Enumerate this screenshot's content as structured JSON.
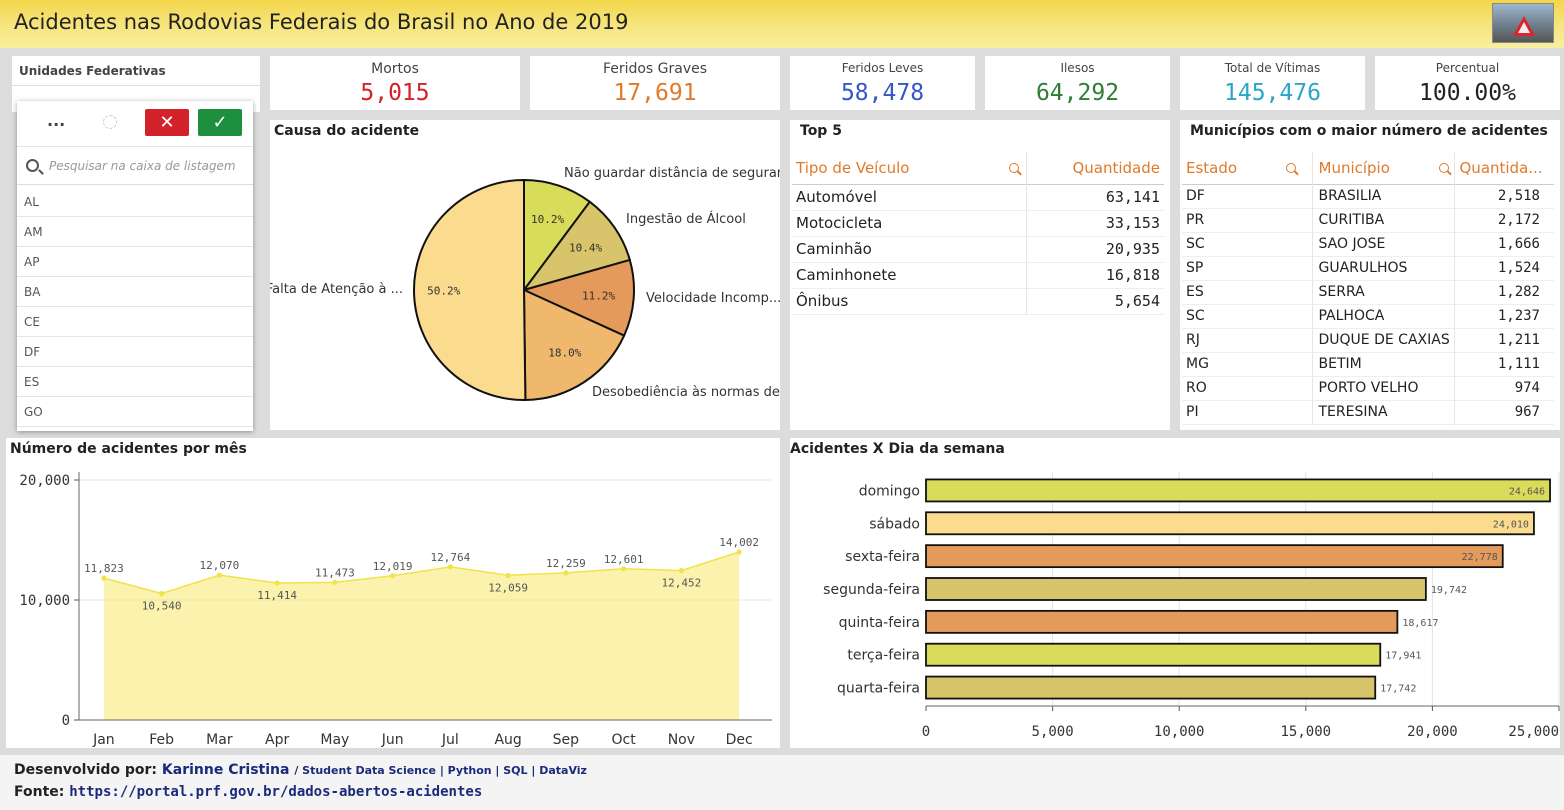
{
  "header": {
    "title": "Acidentes nas Rodovias Federais do Brasil no Ano de 2019"
  },
  "kpis": [
    {
      "label": "Mortos",
      "value": "5,015",
      "color": "#d4202a"
    },
    {
      "label": "Feridos Graves",
      "value": "17,691",
      "color": "#e07a2a"
    },
    {
      "label": "Feridos Leves",
      "value": "58,478",
      "color": "#3556c8"
    },
    {
      "label": "Ilesos",
      "value": "64,292",
      "color": "#2e7d32"
    },
    {
      "label": "Total de Vítimas",
      "value": "145,476",
      "color": "#29a7c8"
    },
    {
      "label": "Percentual",
      "value": "100.00%",
      "color": "#222222"
    }
  ],
  "filter": {
    "title": "Unidades Federativas",
    "more_label": "...",
    "cancel_label": "✕",
    "confirm_label": "✓",
    "search_placeholder": "Pesquisar na caixa de listagem",
    "items": [
      "AL",
      "AM",
      "AP",
      "BA",
      "CE",
      "DF",
      "ES",
      "GO"
    ]
  },
  "panels": {
    "causa_title": "Causa do acidente",
    "top5_title": "Top 5",
    "municipios_title": "Municípios com o maior número de acidentes",
    "mes_title": "Número de acidentes por mês",
    "semana_title": "Acidentes X Dia da semana"
  },
  "top5": {
    "headers": [
      "Tipo de Veículo",
      "Quantidade"
    ],
    "rows": [
      [
        "Automóvel",
        "63,141"
      ],
      [
        "Motocicleta",
        "33,153"
      ],
      [
        "Caminhão",
        "20,935"
      ],
      [
        "Caminhonete",
        "16,818"
      ],
      [
        "Ônibus",
        "5,654"
      ]
    ]
  },
  "municipios": {
    "headers": [
      "Estado",
      "Município",
      "Quantida..."
    ],
    "rows": [
      [
        "DF",
        "BRASILIA",
        "2,518"
      ],
      [
        "PR",
        "CURITIBA",
        "2,172"
      ],
      [
        "SC",
        "SAO JOSE",
        "1,666"
      ],
      [
        "SP",
        "GUARULHOS",
        "1,524"
      ],
      [
        "ES",
        "SERRA",
        "1,282"
      ],
      [
        "SC",
        "PALHOCA",
        "1,237"
      ],
      [
        "RJ",
        "DUQUE DE CAXIAS",
        "1,211"
      ],
      [
        "MG",
        "BETIM",
        "1,111"
      ],
      [
        "RO",
        "PORTO VELHO",
        "974"
      ],
      [
        "PI",
        "TERESINA",
        "967"
      ]
    ]
  },
  "footer": {
    "dev_prefix": "Desenvolvido por:",
    "author": "Karinne Cristina",
    "tagline": "/ Student Data Science | Python | SQL | DataViz",
    "source_prefix": "Fonte:",
    "source_url": "https://portal.prf.gov.br/dados-abertos-acidentes"
  },
  "chart_data": [
    {
      "type": "pie",
      "title": "Causa do acidente",
      "slices": [
        {
          "label": "Não guardar distância de seguran...",
          "value": 10.2,
          "value_label": "10.2%",
          "color": "#d9dc5a"
        },
        {
          "label": "Ingestão de Álcool",
          "value": 10.4,
          "value_label": "10.4%",
          "color": "#d8c46a"
        },
        {
          "label": "Velocidade Incomp...",
          "value": 11.2,
          "value_label": "11.2%",
          "color": "#e39a5a"
        },
        {
          "label": "Desobediência às normas de ...",
          "value": 18.0,
          "value_label": "18.0%",
          "color": "#efb86c"
        },
        {
          "label": "Falta de Atenção à ...",
          "value": 50.2,
          "value_label": "50.2%",
          "color": "#fbdc8e"
        }
      ]
    },
    {
      "type": "area",
      "title": "Número de acidentes por mês",
      "categories": [
        "Jan",
        "Feb",
        "Mar",
        "Apr",
        "May",
        "Jun",
        "Jul",
        "Aug",
        "Sep",
        "Oct",
        "Nov",
        "Dec"
      ],
      "values": [
        11823,
        10540,
        12070,
        11414,
        11473,
        12019,
        12764,
        12059,
        12259,
        12601,
        12452,
        14002
      ],
      "value_labels": [
        "11,823",
        "10,540",
        "12,070",
        "11,414",
        "11,473",
        "12,019",
        "12,764",
        "12,059",
        "12,259",
        "12,601",
        "12,452",
        "14,002"
      ],
      "ylim": [
        0,
        20000
      ],
      "yticks": [
        0,
        10000,
        20000
      ],
      "ytick_labels": [
        "0",
        "10,000",
        "20,000"
      ],
      "color": "#f7e96a"
    },
    {
      "type": "bar",
      "orientation": "horizontal",
      "title": "Acidentes X Dia da semana",
      "categories": [
        "domingo",
        "sábado",
        "sexta-feira",
        "segunda-feira",
        "quinta-feira",
        "terça-feira",
        "quarta-feira"
      ],
      "values": [
        24646,
        24010,
        22778,
        19742,
        18617,
        17941,
        17742
      ],
      "value_labels": [
        "24,646",
        "24,010",
        "22,778",
        "19,742",
        "18,617",
        "17,941",
        "17,742"
      ],
      "colors": [
        "#d9dc5a",
        "#fbdc8e",
        "#e39a5a",
        "#d8c46a",
        "#e39a5a",
        "#d9dc5a",
        "#d8c46a"
      ],
      "xlim": [
        0,
        25000
      ],
      "xticks": [
        0,
        5000,
        10000,
        15000,
        20000,
        25000
      ],
      "xtick_labels": [
        "0",
        "5,000",
        "10,000",
        "15,000",
        "20,000",
        "25,000"
      ]
    }
  ]
}
